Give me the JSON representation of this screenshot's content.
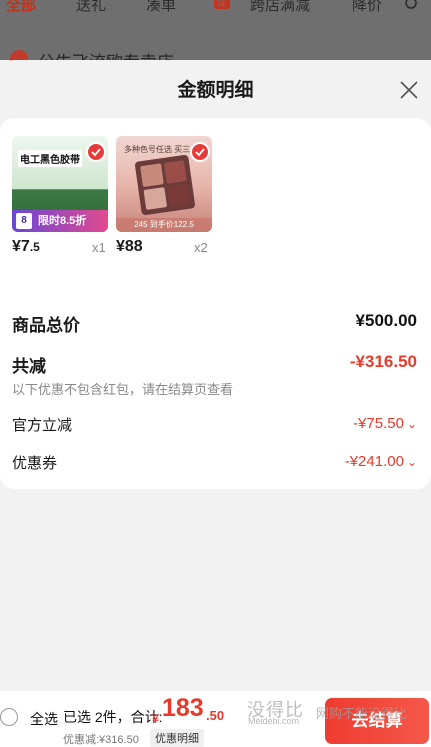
{
  "background_page": {
    "tabs": [
      "全部",
      "送礼",
      "凑单",
      "跨店满减",
      "降价"
    ],
    "badge": "促",
    "store_name": "公牛飞流欧专卖店 ›"
  },
  "sheet": {
    "title": "金额明细",
    "items": [
      {
        "img_tag": "电工黑色胶带",
        "img_promo": "限时8.5折",
        "img_promo_num": "8",
        "price_symbol": "¥",
        "price_int": "7",
        "price_dec": ".5",
        "qty": "x1"
      },
      {
        "img_tag": "多种色号任选 买三件更",
        "img_promo": "245  到手价122.5",
        "price_symbol": "¥",
        "price_int": "88",
        "price_dec": "",
        "qty": "x2"
      }
    ],
    "summary": {
      "goods_total_label": "商品总价",
      "goods_total_value": "¥500.00",
      "total_discount_label": "共减",
      "total_discount_value": "-¥316.50",
      "discount_note": "以下优惠不包含红包，请在结算页查看",
      "official_discount_label": "官方立减",
      "official_discount_value": "-¥75.50",
      "coupon_label": "优惠券",
      "coupon_value": "-¥241.00"
    }
  },
  "bottom_bar": {
    "select_all": "全选",
    "selected_count": "已选 2件，合计:",
    "total_symbol": "¥",
    "total_int": "183",
    "total_dec": ".50",
    "discount_text": "优惠减:¥316.50",
    "detail_chip": "优惠明细",
    "checkout": "去结算",
    "watermark": "没得比",
    "watermark_sub": "Meidebi.com",
    "watermark_2": "网购不能没得比"
  },
  "colors": {
    "accent_red": "#e53a2c",
    "check_red": "#e53b3b"
  }
}
